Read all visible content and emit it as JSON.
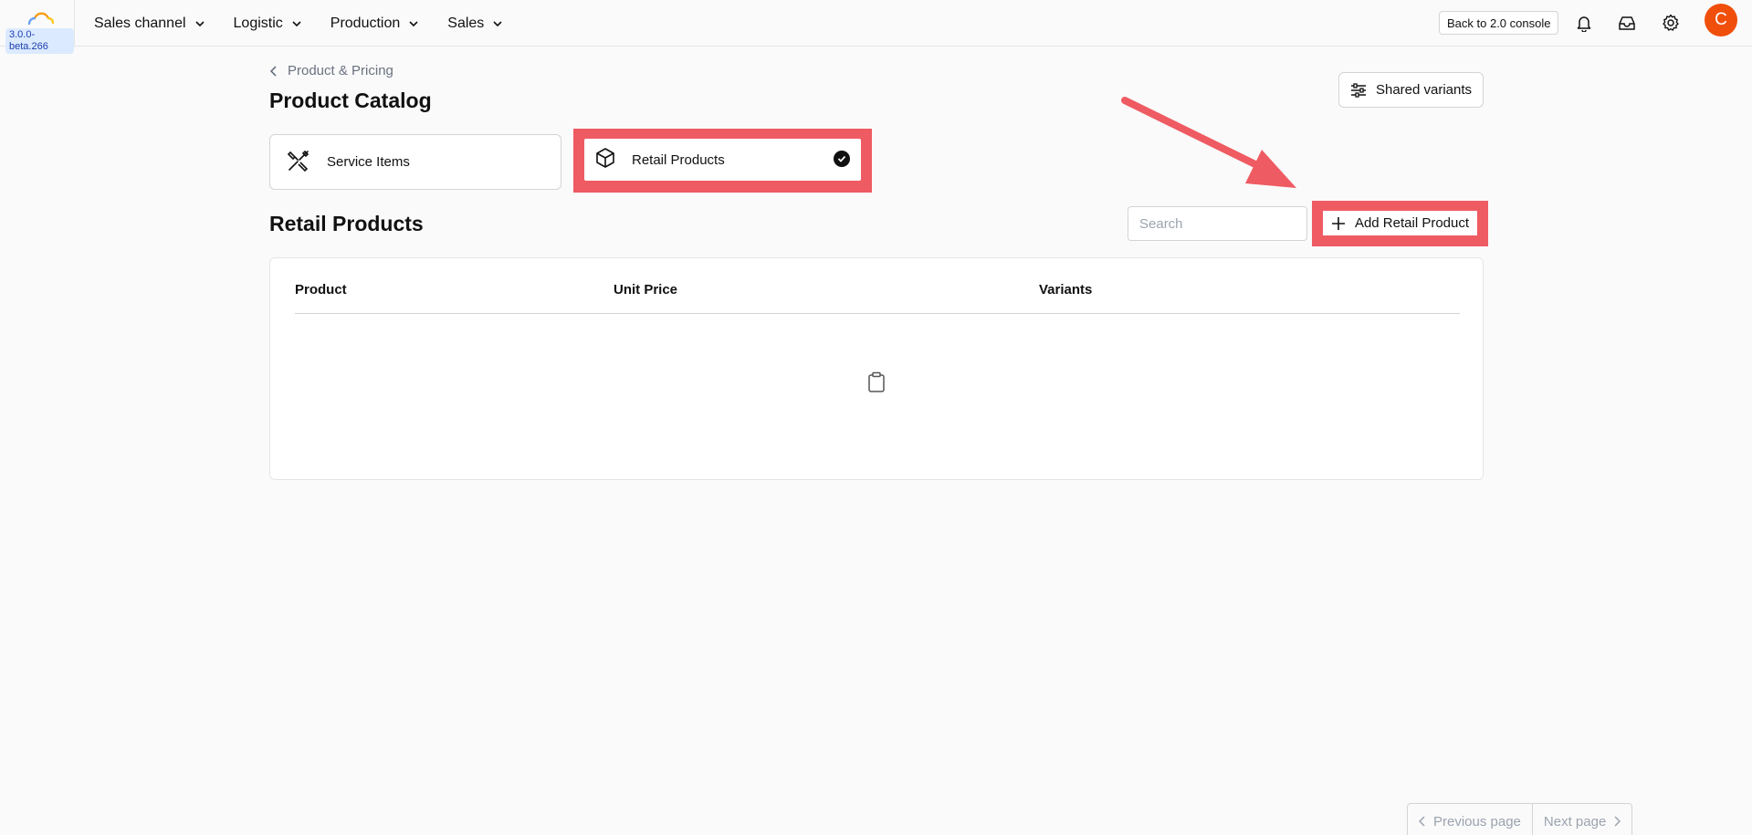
{
  "app": {
    "version": "3.0.0-beta.266",
    "logo_icon": "cloud-logo-icon"
  },
  "nav": {
    "items": [
      {
        "label": "Sales channel",
        "icon": "chevron-down-icon"
      },
      {
        "label": "Logistic",
        "icon": "chevron-down-icon"
      },
      {
        "label": "Production",
        "icon": "chevron-down-icon"
      },
      {
        "label": "Sales",
        "icon": "chevron-down-icon"
      }
    ]
  },
  "header_actions": {
    "back_label": "Back to 2.0 console",
    "icons": [
      "bell-icon",
      "inbox-icon",
      "gear-icon"
    ],
    "avatar_initial": "C",
    "avatar_color": "#f04e0b"
  },
  "breadcrumb": {
    "label": "Product & Pricing",
    "icon": "chevron-left-icon"
  },
  "page": {
    "title": "Product Catalog",
    "shared_variants_label": "Shared variants"
  },
  "catalog_types": [
    {
      "label": "Service Items",
      "icon": "tools-icon",
      "selected": false
    },
    {
      "label": "Retail Products",
      "icon": "box-icon",
      "selected": true
    }
  ],
  "section": {
    "title": "Retail Products",
    "search_placeholder": "Search",
    "add_label": "Add Retail Product"
  },
  "table": {
    "columns": [
      "Product",
      "Unit Price",
      "Variants"
    ],
    "rows": [],
    "empty_icon": "clipboard-icon"
  },
  "pagination": {
    "previous_label": "Previous page",
    "next_label": "Next page"
  },
  "annotations": {
    "highlight_color": "#ef5b62",
    "arrow_color": "#ef5b62"
  }
}
